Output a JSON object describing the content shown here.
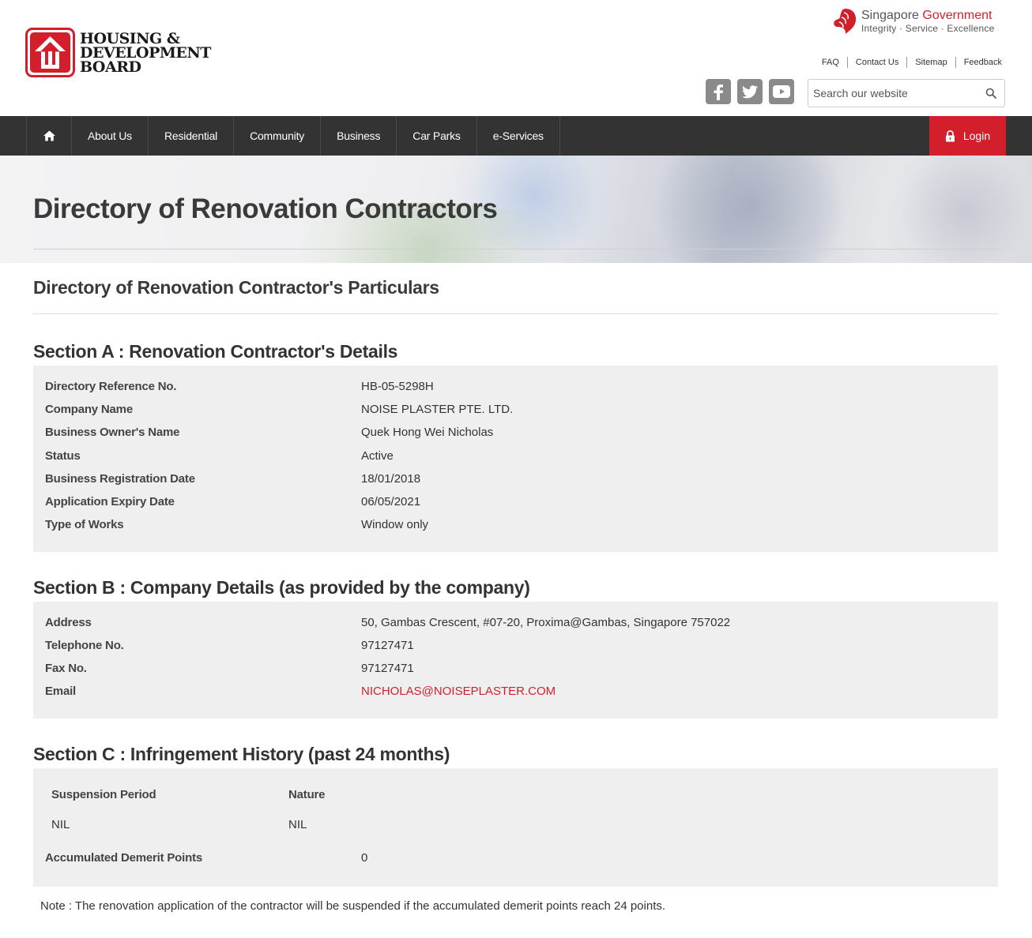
{
  "header": {
    "logo_lines": [
      "HOUSING &",
      "DEVELOPMENT",
      "BOARD"
    ],
    "gov_name_a": "Singapore",
    "gov_name_b": "Government",
    "gov_tagline": "Integrity  ·  Service  ·  Excellence",
    "util_links": [
      "FAQ",
      "Contact Us",
      "Sitemap",
      "Feedback"
    ],
    "search_placeholder": "Search our website"
  },
  "nav": {
    "items": [
      "About Us",
      "Residential",
      "Community",
      "Business",
      "Car Parks",
      "e-Services"
    ],
    "login_label": "Login"
  },
  "banner": {
    "title": "Directory of Renovation Contractors"
  },
  "page": {
    "subtitle": "Directory of Renovation Contractor's Particulars"
  },
  "section_a": {
    "title": "Section A : Renovation Contractor's Details",
    "rows": [
      {
        "label": "Directory Reference No.",
        "value": "HB-05-5298H"
      },
      {
        "label": "Company Name",
        "value": "NOISE PLASTER PTE. LTD."
      },
      {
        "label": "Business Owner's Name",
        "value": "Quek Hong Wei Nicholas"
      },
      {
        "label": "Status",
        "value": "Active"
      },
      {
        "label": "Business Registration Date",
        "value": "18/01/2018"
      },
      {
        "label": "Application Expiry Date",
        "value": "06/05/2021"
      },
      {
        "label": "Type of Works",
        "value": "Window only"
      }
    ]
  },
  "section_b": {
    "title": "Section B : Company Details (as provided by the company)",
    "rows": [
      {
        "label": "Address",
        "value": "50, Gambas Crescent, #07-20, Proxima@Gambas, Singapore 757022"
      },
      {
        "label": "Telephone No.",
        "value": "97127471"
      },
      {
        "label": "Fax No.",
        "value": "97127471"
      },
      {
        "label": "Email",
        "value": "NICHOLAS@NOISEPLASTER.COM"
      }
    ]
  },
  "section_c": {
    "title": "Section C : Infringement History (past 24 months)",
    "col_period": "Suspension Period",
    "col_nature": "Nature",
    "period_value": "NIL",
    "nature_value": "NIL",
    "demerit_label": "Accumulated Demerit Points",
    "demerit_value": "0"
  },
  "note": "Note : The renovation application of the contractor will be suspended if the accumulated demerit points reach 24 points.",
  "colors": {
    "brand_red": "#d31f2c",
    "nav_bg": "#333333",
    "panel_bg": "#efefef"
  }
}
